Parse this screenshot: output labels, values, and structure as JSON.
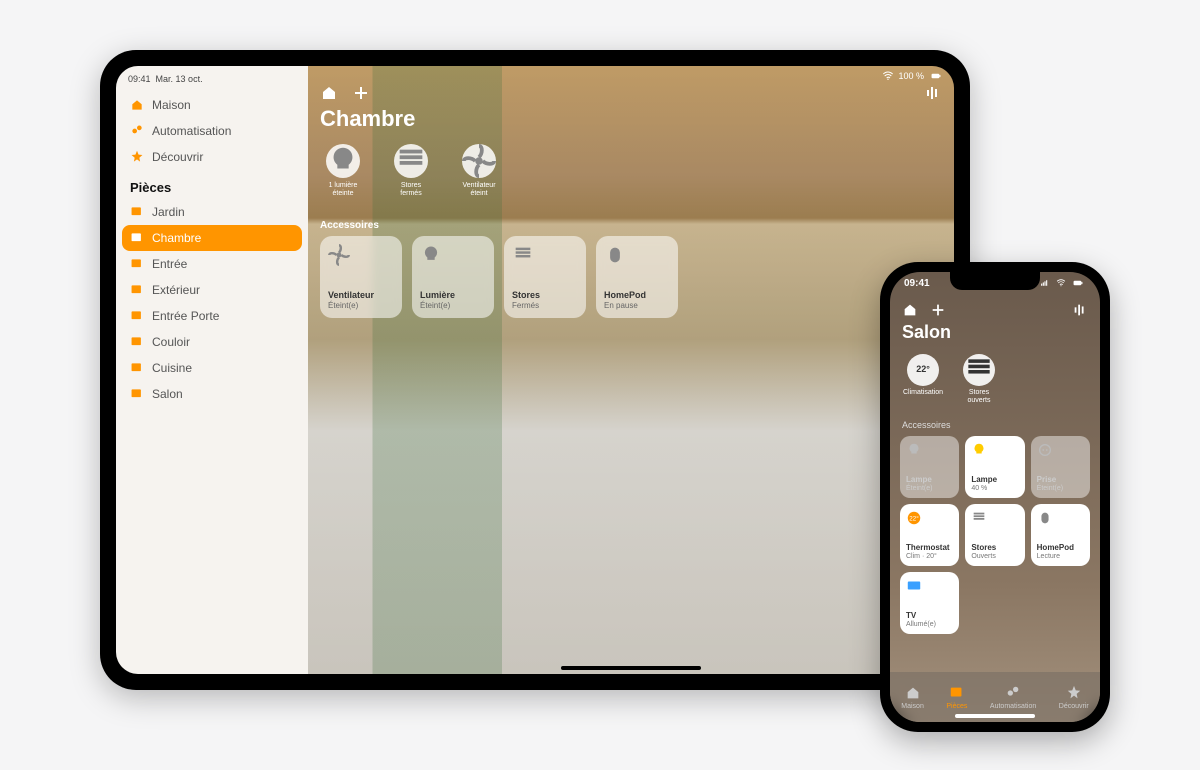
{
  "colors": {
    "accent": "#ff9500"
  },
  "ipad": {
    "status": {
      "time": "09:41",
      "date": "Mar. 13 oct.",
      "battery": "100 %"
    },
    "sidebar": {
      "top": [
        {
          "icon": "house-icon",
          "label": "Maison"
        },
        {
          "icon": "automation-icon",
          "label": "Automatisation"
        },
        {
          "icon": "star-icon",
          "label": "Découvrir"
        }
      ],
      "section_title": "Pièces",
      "rooms": [
        {
          "label": "Jardin"
        },
        {
          "label": "Chambre",
          "selected": true
        },
        {
          "label": "Entrée"
        },
        {
          "label": "Extérieur"
        },
        {
          "label": "Entrée Porte"
        },
        {
          "label": "Couloir"
        },
        {
          "label": "Cuisine"
        },
        {
          "label": "Salon"
        }
      ]
    },
    "room_title": "Chambre",
    "scenes": [
      {
        "icon": "bulb-icon",
        "line1": "1 lumière",
        "line2": "éteinte"
      },
      {
        "icon": "blinds-icon",
        "line1": "Stores",
        "line2": "fermés"
      },
      {
        "icon": "fan-icon",
        "line1": "Ventilateur",
        "line2": "éteint"
      }
    ],
    "accessories_title": "Accessoires",
    "tiles": [
      {
        "icon": "fan-icon",
        "label": "Ventilateur",
        "status": "Éteint(e)"
      },
      {
        "icon": "bulb-icon",
        "label": "Lumière",
        "status": "Éteint(e)"
      },
      {
        "icon": "blinds-icon",
        "label": "Stores",
        "status": "Fermés"
      },
      {
        "icon": "homepod-icon",
        "label": "HomePod",
        "status": "En pause"
      }
    ]
  },
  "iphone": {
    "status": {
      "time": "09:41"
    },
    "room_title": "Salon",
    "scenes": [
      {
        "value": "22°",
        "line1": "Climatisation"
      },
      {
        "icon": "blinds-icon",
        "line1": "Stores",
        "line2": "ouverts"
      }
    ],
    "accessories_title": "Accessoires",
    "tiles": [
      {
        "icon": "bulb-icon",
        "label": "Lampe",
        "status": "Éteint(e)",
        "dim": true
      },
      {
        "icon": "bulb-on-icon",
        "label": "Lampe",
        "status": "40 %",
        "on": true
      },
      {
        "icon": "outlet-icon",
        "label": "Prise",
        "status": "Éteint(e)",
        "dim": true
      },
      {
        "icon": "thermostat-icon",
        "label": "Thermostat",
        "status": "Clim · 20°",
        "on": true
      },
      {
        "icon": "blinds-icon",
        "label": "Stores",
        "status": "Ouverts",
        "on": true
      },
      {
        "icon": "homepod-icon",
        "label": "HomePod",
        "status": "Lecture",
        "on": true
      },
      {
        "icon": "tv-icon",
        "label": "TV",
        "status": "Allumé(e)",
        "on": true
      }
    ],
    "tabs": [
      {
        "icon": "house-icon",
        "label": "Maison"
      },
      {
        "icon": "room-icon",
        "label": "Pièces",
        "active": true
      },
      {
        "icon": "automation-icon",
        "label": "Automatisation"
      },
      {
        "icon": "star-icon",
        "label": "Découvrir"
      }
    ]
  }
}
